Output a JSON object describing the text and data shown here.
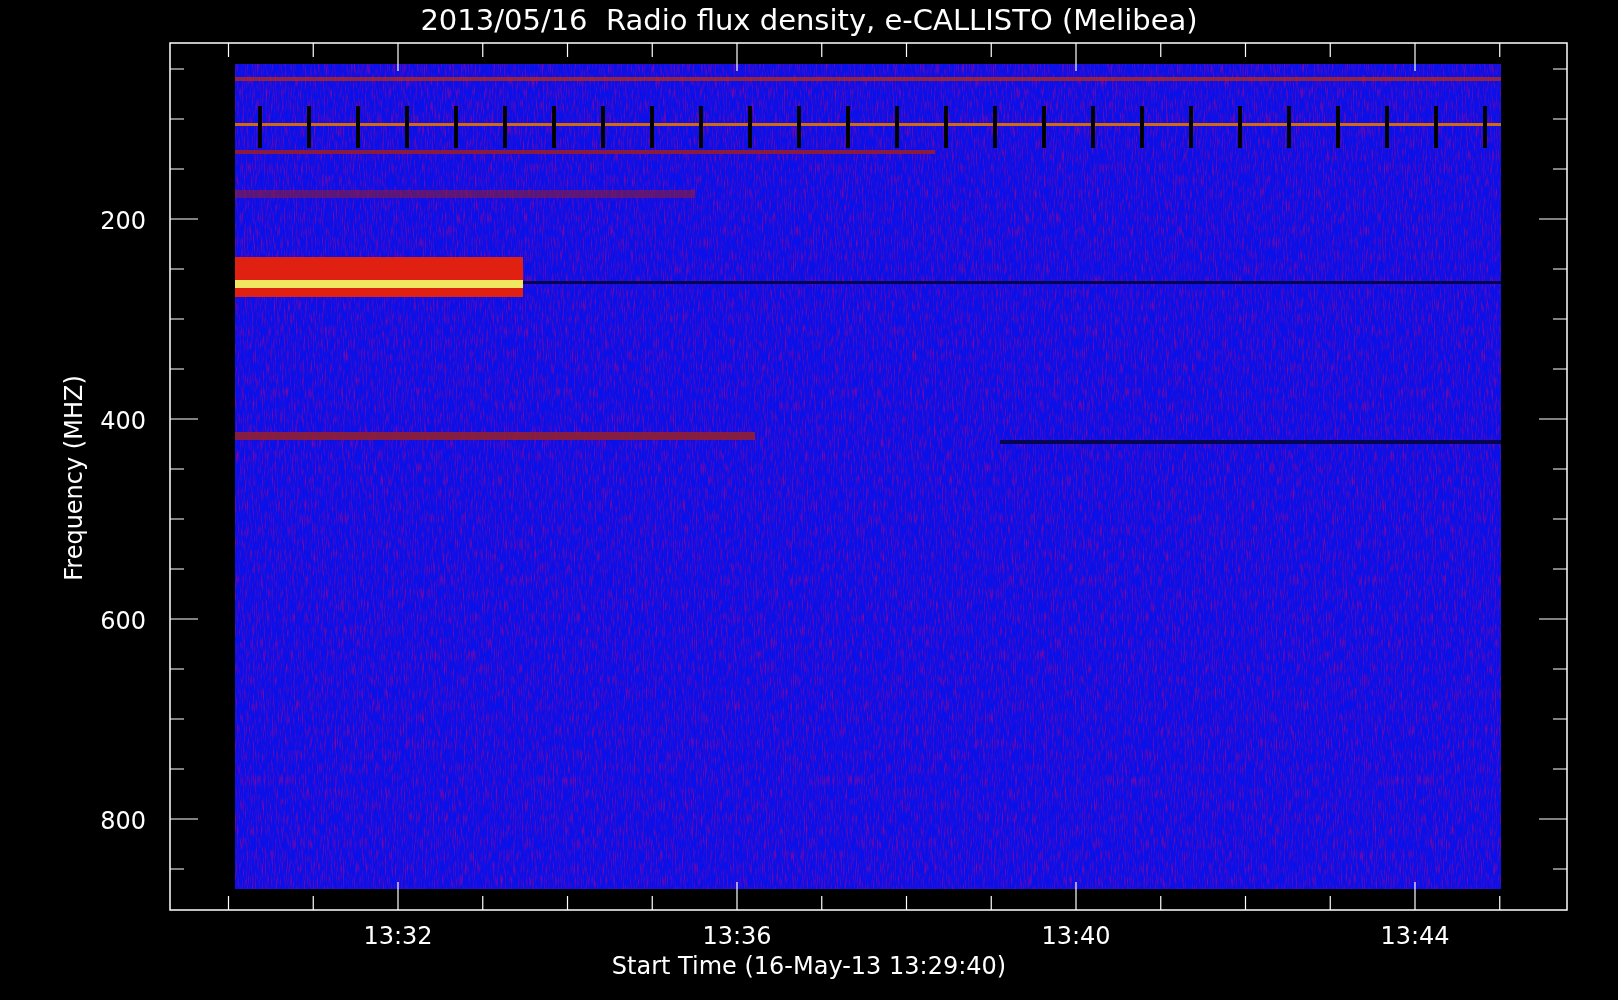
{
  "title": "2013/05/16  Radio flux density, e-CALLISTO (Melibea)",
  "y_axis": {
    "label": "Frequency (MHZ)",
    "ticks": [
      "200",
      "400",
      "600",
      "800"
    ]
  },
  "x_axis": {
    "label": "Start Time (16-May-13 13:29:40)",
    "ticks": [
      "13:32",
      "13:36",
      "13:40",
      "13:44"
    ]
  }
}
